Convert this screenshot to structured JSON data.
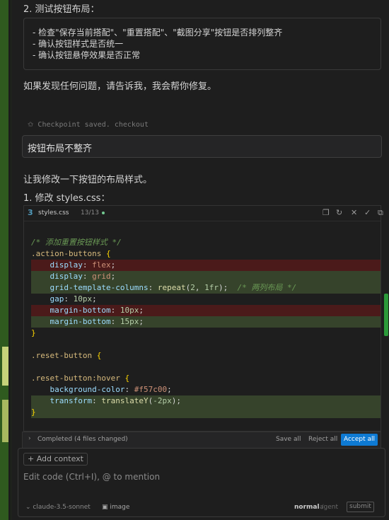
{
  "step2": {
    "title": "2. 测试按钮布局：",
    "items": [
      "-  检查\"保存当前搭配\"、\"重置搭配\"、\"截图分享\"按钮是否排列整齐",
      "-  确认按钮样式是否统一",
      "-  确认按钮悬停效果是否正常"
    ]
  },
  "closing": "如果发现任何问题，请告诉我，我会帮你修复。",
  "checkpoint": {
    "icon": "pin-icon",
    "text": "Checkpoint saved.",
    "link": "checkout"
  },
  "user_message": "按钮布局不整齐",
  "assistant": {
    "intro": "让我修改一下按钮的布局样式。",
    "step1": "1. 修改 styles.css："
  },
  "editor": {
    "filename": "styles.css",
    "count": "13/13",
    "icons": [
      "copy-icon",
      "refresh-icon",
      "close-icon",
      "check-icon",
      "open-icon"
    ]
  },
  "code_lines": [
    {
      "kind": "normal",
      "parts": []
    },
    {
      "kind": "normal",
      "parts": [
        [
          "c-com",
          "/* 添加重置按钮样式 */"
        ]
      ]
    },
    {
      "kind": "normal",
      "parts": [
        [
          "c-sel",
          ".action-buttons"
        ],
        [
          "c-pun",
          " "
        ],
        [
          "c-brace",
          "{"
        ]
      ]
    },
    {
      "kind": "del",
      "parts": [
        [
          "c-pun",
          "    "
        ],
        [
          "c-prop",
          "display"
        ],
        [
          "c-pun",
          ": "
        ],
        [
          "c-val",
          "flex"
        ],
        [
          "c-pun",
          ";"
        ]
      ]
    },
    {
      "kind": "add",
      "parts": [
        [
          "c-pun",
          "    "
        ],
        [
          "c-prop",
          "display"
        ],
        [
          "c-pun",
          ": "
        ],
        [
          "c-val",
          "grid"
        ],
        [
          "c-pun",
          ";"
        ]
      ]
    },
    {
      "kind": "add",
      "parts": [
        [
          "c-pun",
          "    "
        ],
        [
          "c-prop",
          "grid-template-columns"
        ],
        [
          "c-pun",
          ": "
        ],
        [
          "c-fn",
          "repeat"
        ],
        [
          "c-pun",
          "("
        ],
        [
          "c-num",
          "2"
        ],
        [
          "c-pun",
          ", "
        ],
        [
          "c-num",
          "1fr"
        ],
        [
          "c-pun",
          ");  "
        ],
        [
          "c-com",
          "/* 两列布局 */"
        ]
      ]
    },
    {
      "kind": "normal",
      "parts": [
        [
          "c-pun",
          "    "
        ],
        [
          "c-prop",
          "gap"
        ],
        [
          "c-pun",
          ": "
        ],
        [
          "c-num",
          "10px"
        ],
        [
          "c-pun",
          ";"
        ]
      ]
    },
    {
      "kind": "del",
      "parts": [
        [
          "c-pun",
          "    "
        ],
        [
          "c-prop",
          "margin-bottom"
        ],
        [
          "c-pun",
          ": "
        ],
        [
          "c-num",
          "10px"
        ],
        [
          "c-pun",
          ";"
        ]
      ]
    },
    {
      "kind": "add",
      "parts": [
        [
          "c-pun",
          "    "
        ],
        [
          "c-prop",
          "margin-bottom"
        ],
        [
          "c-pun",
          ": "
        ],
        [
          "c-num",
          "15px"
        ],
        [
          "c-pun",
          ";"
        ]
      ]
    },
    {
      "kind": "normal",
      "parts": [
        [
          "c-brace",
          "}"
        ]
      ]
    },
    {
      "kind": "normal",
      "parts": []
    },
    {
      "kind": "normal",
      "parts": [
        [
          "c-sel",
          ".reset-button"
        ],
        [
          "c-pun",
          " "
        ],
        [
          "c-brace",
          "{"
        ]
      ]
    },
    {
      "kind": "normal",
      "parts": []
    },
    {
      "kind": "normal",
      "parts": [
        [
          "c-sel",
          ".reset-button:hover"
        ],
        [
          "c-pun",
          " "
        ],
        [
          "c-brace",
          "{"
        ]
      ]
    },
    {
      "kind": "normal",
      "parts": [
        [
          "c-pun",
          "    "
        ],
        [
          "c-prop",
          "background-color"
        ],
        [
          "c-pun",
          ": "
        ],
        [
          "c-val",
          "#f57c00"
        ],
        [
          "c-pun",
          ";"
        ]
      ]
    },
    {
      "kind": "add",
      "parts": [
        [
          "c-pun",
          "    "
        ],
        [
          "c-prop",
          "transform"
        ],
        [
          "c-pun",
          ": "
        ],
        [
          "c-fn",
          "translateY"
        ],
        [
          "c-pun",
          "("
        ],
        [
          "c-num",
          "-2px"
        ],
        [
          "c-pun",
          ");"
        ]
      ]
    },
    {
      "kind": "add",
      "parts": [
        [
          "c-brace",
          "}"
        ]
      ]
    },
    {
      "kind": "normal",
      "parts": []
    }
  ],
  "status": {
    "completed": "Completed",
    "files": "(4 files changed)",
    "save_all": "Save all",
    "reject_all": "Reject all",
    "accept_all": "Accept all"
  },
  "composer": {
    "add_context": "+ Add context",
    "placeholder": "Edit code (Ctrl+I), @ to mention",
    "model": "claude-3.5-sonnet",
    "image": "image",
    "mode": "normal",
    "separator": "/",
    "agent": "agent",
    "submit": "submit"
  },
  "colors": {
    "accent": "#0e7ad3",
    "del_bg": "#4b1a1a",
    "add_bg": "#36432b"
  }
}
